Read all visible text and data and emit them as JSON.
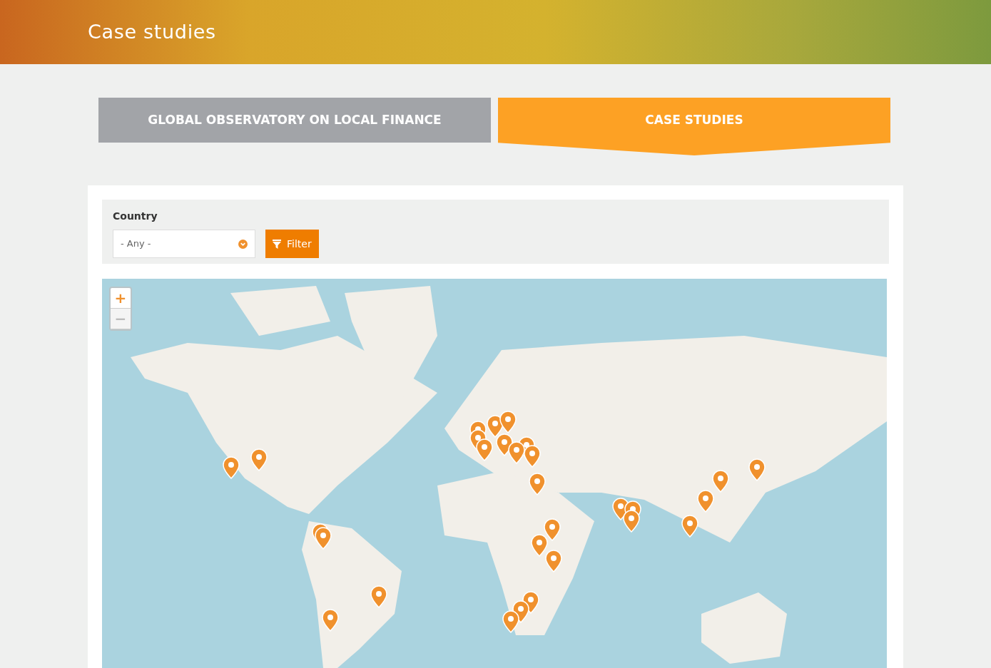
{
  "header": {
    "title": "Case studies"
  },
  "tabs": [
    {
      "label": "GLOBAL OBSERVATORY ON LOCAL FINANCE",
      "selected": false
    },
    {
      "label": "CASE STUDIES",
      "selected": true
    }
  ],
  "filter": {
    "label": "Country",
    "select_value": "- Any -",
    "button": "Filter"
  },
  "map": {
    "kind": "picture",
    "zoom_controls": [
      {
        "label": "+",
        "disabled": false
      },
      {
        "label": "−",
        "disabled": true
      }
    ]
  }
}
